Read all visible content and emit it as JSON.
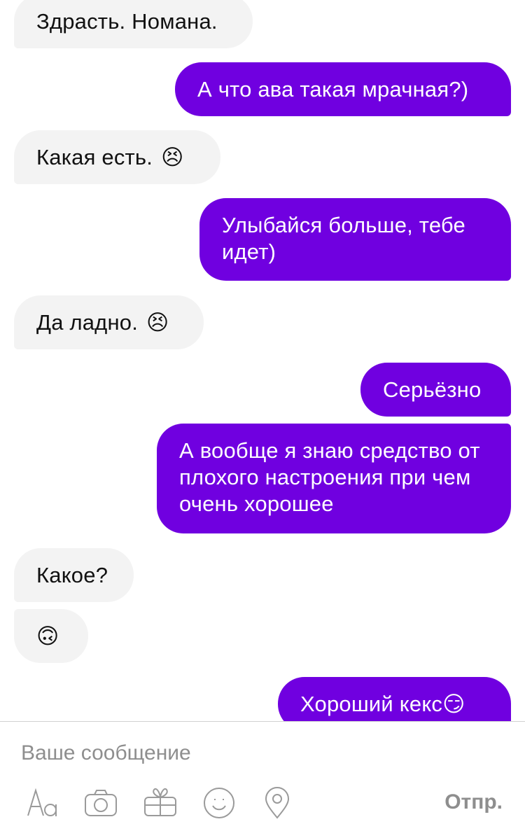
{
  "messages": [
    {
      "side": "in",
      "text": "Здрасть. Номана.",
      "emoji": ""
    },
    {
      "side": "out",
      "text": "А что ава такая мрачная?)",
      "emoji": ""
    },
    {
      "side": "in",
      "text": "Какая есть.",
      "emoji": "😣"
    },
    {
      "side": "out",
      "text": "Улыбайся больше, тебе идет)",
      "emoji": ""
    },
    {
      "side": "in",
      "text": "Да ладно.",
      "emoji": "😣"
    },
    {
      "side": "out",
      "text": "Серьёзно",
      "emoji": ""
    },
    {
      "side": "out",
      "text": "А вообще я знаю средство от плохого настроения при чем очень хорошее",
      "emoji": ""
    },
    {
      "side": "in",
      "text": "Какое?",
      "emoji": ""
    },
    {
      "side": "in",
      "text": "",
      "emoji": "🙃"
    },
    {
      "side": "out",
      "text": "Хороший кекс",
      "emoji": "😏"
    }
  ],
  "composer": {
    "placeholder": "Ваше сообщение",
    "send_label": "Отпр.",
    "tools": [
      "text-format-icon",
      "camera-icon",
      "gift-icon",
      "sticker-smile-icon",
      "location-pin-icon"
    ]
  },
  "colors": {
    "outgoing": "#7000e0",
    "incoming": "#f3f3f3",
    "muted": "#8e8e8e"
  }
}
